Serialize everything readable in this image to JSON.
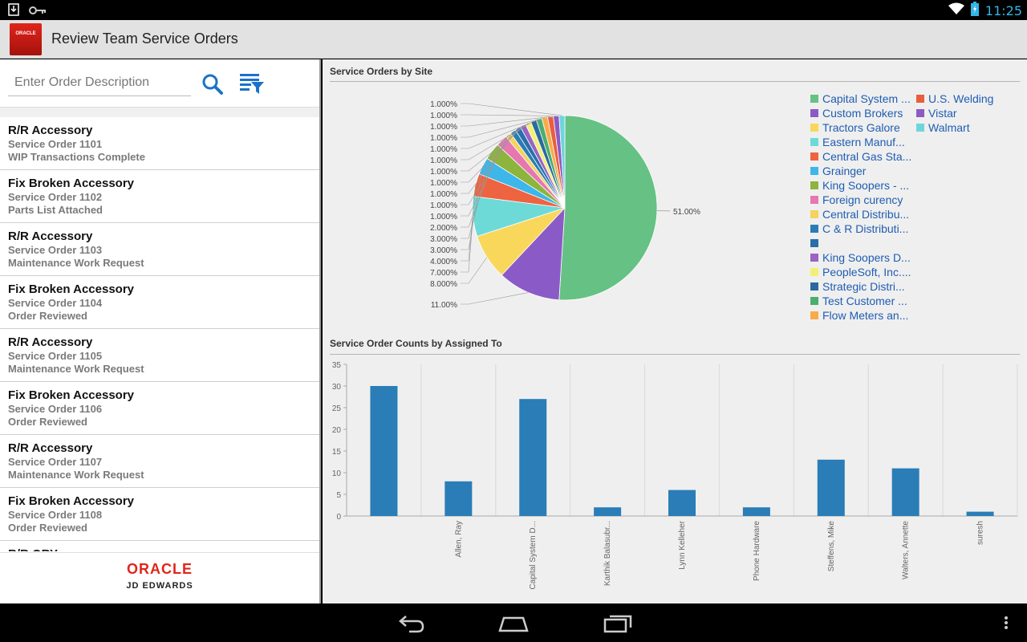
{
  "status_bar": {
    "time": "11:25"
  },
  "app": {
    "title": "Review Team Service Orders",
    "logo_text": "ORACLE"
  },
  "search": {
    "placeholder": "Enter Order Description"
  },
  "orders": [
    {
      "title": "R/R Accessory",
      "number": "Service Order 1101",
      "status": "WIP Transactions Complete"
    },
    {
      "title": "Fix Broken Accessory",
      "number": "Service Order 1102",
      "status": "Parts List Attached"
    },
    {
      "title": "R/R Accessory",
      "number": "Service Order 1103",
      "status": "Maintenance Work Request"
    },
    {
      "title": "Fix Broken Accessory",
      "number": "Service Order 1104",
      "status": "Order Reviewed"
    },
    {
      "title": "R/R Accessory",
      "number": "Service Order 1105",
      "status": "Maintenance Work Request"
    },
    {
      "title": "Fix Broken Accessory",
      "number": "Service Order 1106",
      "status": "Order Reviewed"
    },
    {
      "title": "R/R Accessory",
      "number": "Service Order 1107",
      "status": "Maintenance Work Request"
    },
    {
      "title": "Fix Broken Accessory",
      "number": "Service Order 1108",
      "status": "Order Reviewed"
    },
    {
      "title": "R/R ORY",
      "number": "",
      "status": ""
    }
  ],
  "footer": {
    "oracle": "ORACLE",
    "jde": "JD EDWARDS"
  },
  "pie_section_title": "Service Orders by Site",
  "bar_section_title": "Service Order Counts by Assigned To",
  "chart_data": [
    {
      "type": "pie",
      "title": "Service Orders by Site",
      "slices": [
        {
          "label": "Capital System ...",
          "value": 51,
          "display": "51.00%",
          "color": "#66c184"
        },
        {
          "label": "Custom Brokers",
          "value": 11,
          "display": "11.00%",
          "color": "#8a5bc7"
        },
        {
          "label": "Tractors Galore",
          "value": 8,
          "display": "8.000%",
          "color": "#f8d75b"
        },
        {
          "label": "Eastern Manuf...",
          "value": 7,
          "display": "7.000%",
          "color": "#6ddad8"
        },
        {
          "label": "Central Gas Sta...",
          "value": 4,
          "display": "4.000%",
          "color": "#ee6340"
        },
        {
          "label": "Grainger",
          "value": 3,
          "display": "3.000%",
          "color": "#3db6ea"
        },
        {
          "label": "King Soopers - ...",
          "value": 3,
          "display": "3.000%",
          "color": "#8db43c"
        },
        {
          "label": "Foreign curency",
          "value": 2,
          "display": "2.000%",
          "color": "#e577b1"
        },
        {
          "label": "Central Distribu...",
          "value": 1,
          "display": "1.000%",
          "color": "#f4d35e"
        },
        {
          "label": "C & R Distributi...",
          "value": 1,
          "display": "1.000%",
          "color": "#2a7cb5"
        },
        {
          "label": "",
          "value": 1,
          "display": "1.000%",
          "color": "#2a6fa8"
        },
        {
          "label": "King Soopers D...",
          "value": 1,
          "display": "1.000%",
          "color": "#9a63c4"
        },
        {
          "label": "PeopleSoft, Inc....",
          "value": 1,
          "display": "1.000%",
          "color": "#f2ef78"
        },
        {
          "label": "Strategic Distri...",
          "value": 1,
          "display": "1.000%",
          "color": "#2a6a9e"
        },
        {
          "label": "Test Customer ...",
          "value": 1,
          "display": "1.000%",
          "color": "#4cae6e"
        },
        {
          "label": "Flow Meters an...",
          "value": 1,
          "display": "1.000%",
          "color": "#f8ab4a"
        },
        {
          "label": "U.S. Welding",
          "value": 1,
          "display": "1.000%",
          "color": "#e95e40"
        },
        {
          "label": "Vistar",
          "value": 1,
          "display": "1.000%",
          "color": "#8d5ac2"
        },
        {
          "label": "Walmart",
          "value": 1,
          "display": "1.000%",
          "color": "#6fd5dd"
        }
      ]
    },
    {
      "type": "bar",
      "title": "Service Order Counts by Assigned To",
      "categories": [
        "",
        "Allen, Ray",
        "Capital System D...",
        "Karthik Balasubr...",
        "Lynn Kelleher",
        "Phone Hardware",
        "Steffens, Mike",
        "Walters, Annette",
        "suresh"
      ],
      "values": [
        30,
        8,
        27,
        2,
        6,
        2,
        13,
        11,
        1
      ],
      "ylim": [
        0,
        35
      ],
      "yticks": [
        0,
        5,
        10,
        15,
        20,
        25,
        30,
        35
      ],
      "color": "#2a7db6",
      "grid": true
    }
  ]
}
